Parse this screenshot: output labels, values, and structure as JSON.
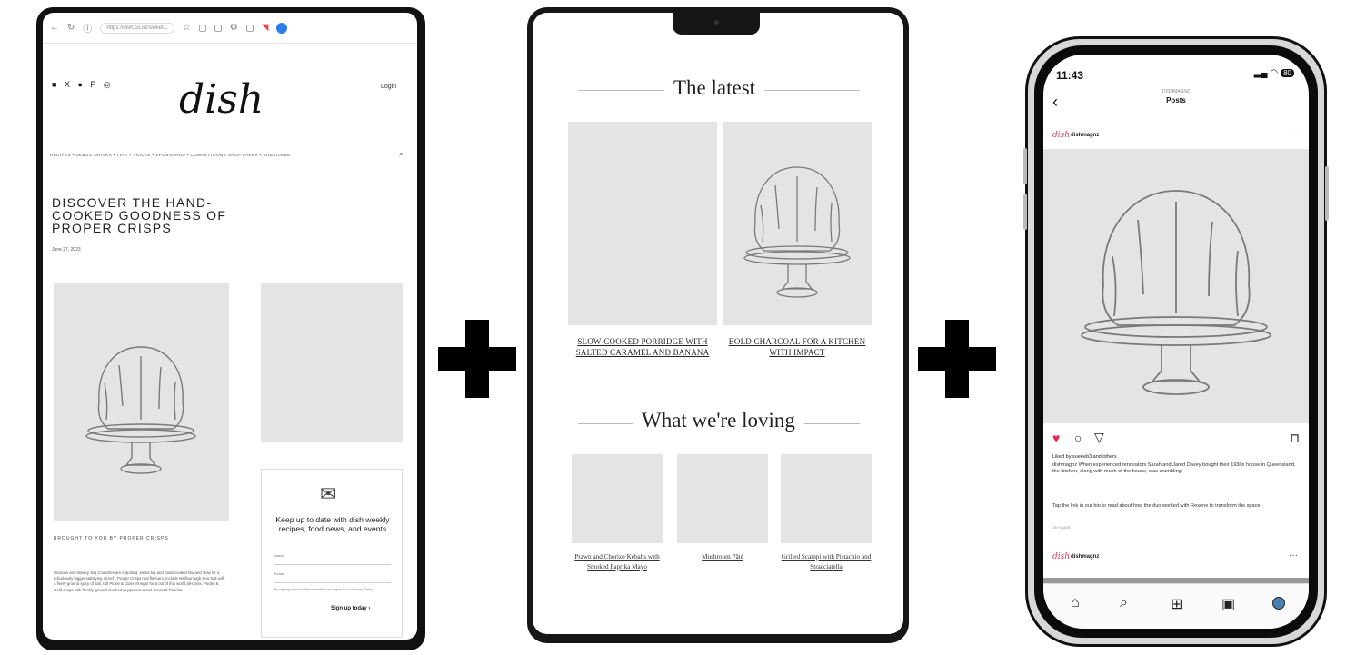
{
  "browser": {
    "url": "https://dish.co.nz/sweet..."
  },
  "site": {
    "social_icons": "■ X ● P ◎",
    "logo": "dish",
    "login": "Login",
    "nav": "RECIPES  •  DEBUG DRINKS  •  TIPS + TRICKS  •  SPONSORED  •  COMPETITIONS   SHOP   FAKER  •  SUBSCRIBE",
    "article_title": "DISCOVER THE HAND-COOKED GOODNESS OF PROPER CRISPS",
    "date": "June 27, 2023",
    "brought_by": "BROUGHT TO YOU BY PROPER CRISPS",
    "body": "Glorious and blowey. Big Crunches are imported, sliced big and hand-cooked low and slow for a ridiculously bigger satisfying crunch. Proper Crisps real flavours, include Marlborough Sea Salt with a finely ground spicy of salt, Dill Pickle & Cider Vinegar for a out of this world all-cross, Purple & Gold crisps with freshly ground crushed pepperocino and Smoked Paprika."
  },
  "newsletter": {
    "heading": "Keep up to date with dish weekly recipes, food news, and events",
    "field_name": "Name",
    "field_email": "Email",
    "fine_print": "By signing up to the dish newsletter, you agree to our Privacy Policy",
    "signup": "Sign up today ›"
  },
  "tablet": {
    "latest_heading": "The latest",
    "latest": [
      {
        "caption": "SLOW-COOKED PORRIDGE WITH SALTED CARAMEL AND BANANA"
      },
      {
        "caption": "BOLD CHARCOAL FOR A KITCHEN WITH IMPACT"
      }
    ],
    "loving_heading": "What we're loving",
    "loving": [
      {
        "caption": "Prawn and Chorizo Kebabs with Smoked Paprika Mayo"
      },
      {
        "caption": "Mushroom Pâté"
      },
      {
        "caption": "Grilled Scampi with Pistachio and Stracciatella"
      }
    ]
  },
  "phone": {
    "time": "11:43",
    "battery": "80",
    "header_sub": "DISHMAGNZ",
    "header_title": "Posts",
    "username": "dishmagnz",
    "liked_by": "Liked by sueeeb3 and others",
    "caption": "dishmagnz When experienced renovators Sarah and Jared Davey bought their 1930s house in Queensland, the kitchen, along with much of the house, was crumbling!",
    "caption2": "Tap the link in our bio to read about how the duo worked with Resene to transform the space.",
    "post_date": "16 August",
    "username2": "dishmagnz"
  }
}
